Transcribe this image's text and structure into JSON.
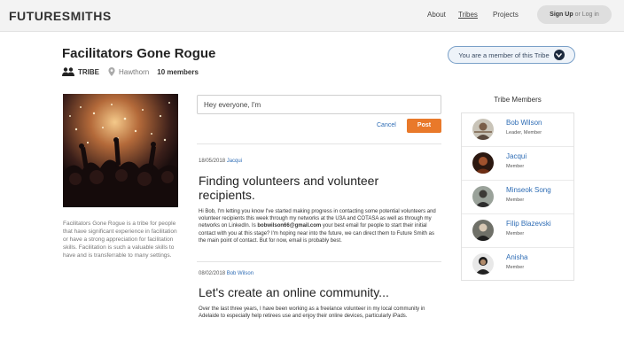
{
  "nav": {
    "logo": "FUTURESMITHS",
    "links": [
      "About",
      "Tribes",
      "Projects"
    ],
    "signup": "Sign Up",
    "or_login": "or Log in"
  },
  "tribe": {
    "title": "Facilitators Gone Rogue",
    "type_label": "TRIBE",
    "location": "Hawthorn",
    "members_count": "10 members",
    "membership_status": "You are a member of this Tribe",
    "about": "Facilitators Gone Rogue is a tribe for people that have significant experience in facilitation or have a strong appreciation for facilitation skills. Facilitation is such a valuable skills to have and is transferrable to many settings."
  },
  "composer": {
    "value": "Hey everyone, I'm",
    "cancel_label": "Cancel",
    "post_label": "Post"
  },
  "posts": [
    {
      "date": "18/05/2018",
      "author": "Jacqui",
      "title": "Finding volunteers and volunteer recipients.",
      "body_before": "Hi Bob, I'm letting you know I've started making progress in contacting some potential volunteers and volunteer recipients this week through my networks at the U3A and COTASA as well as through my networks on LinkedIn. Is ",
      "email": "bobwilson66@gmail.com",
      "body_after": " your best email for people to start their initial contact with you at this stage? I'm hoping near into the future, we can direct them to Future Smith as the main point of contact. But for now, email is probably best."
    },
    {
      "date": "08/02/2018",
      "author": "Bob Wilson",
      "title": "Let's create an online community...",
      "body": "Over the last three years, I have been working as a freelance volunteer in my local community in Adelaide to especially help retirees use and enjoy their online devices, particularly iPads."
    }
  ],
  "members": {
    "heading": "Tribe Members",
    "list": [
      {
        "name": "Bob Wilson",
        "role": "Leader, Member"
      },
      {
        "name": "Jacqui",
        "role": "Member"
      },
      {
        "name": "Minseok Song",
        "role": "Member"
      },
      {
        "name": "Filip Blazevski",
        "role": "Member"
      },
      {
        "name": "Anisha",
        "role": "Member"
      }
    ]
  },
  "colors": {
    "accent_orange": "#e9792a",
    "link_blue": "#2f6db5"
  }
}
